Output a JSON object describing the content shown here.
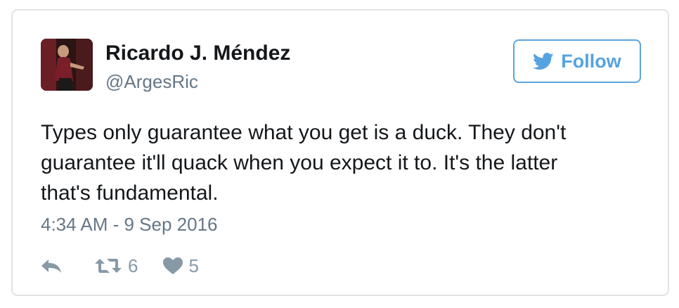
{
  "author": {
    "name": "Ricardo J. Méndez",
    "handle": "@ArgesRic"
  },
  "follow_button": {
    "label": "Follow",
    "icon": "twitter-bird-icon",
    "color": "#55a3e0"
  },
  "tweet": {
    "text_lines": [
      "Types only guarantee what you get is a duck. They don't",
      "guarantee it'll quack when you expect it to. It's the latter",
      "that's fundamental."
    ],
    "timestamp": "4:34 AM - 9 Sep 2016"
  },
  "actions": {
    "reply": {
      "icon": "reply-icon"
    },
    "retweet": {
      "icon": "retweet-icon",
      "count": "6"
    },
    "like": {
      "icon": "heart-icon",
      "count": "5"
    }
  }
}
